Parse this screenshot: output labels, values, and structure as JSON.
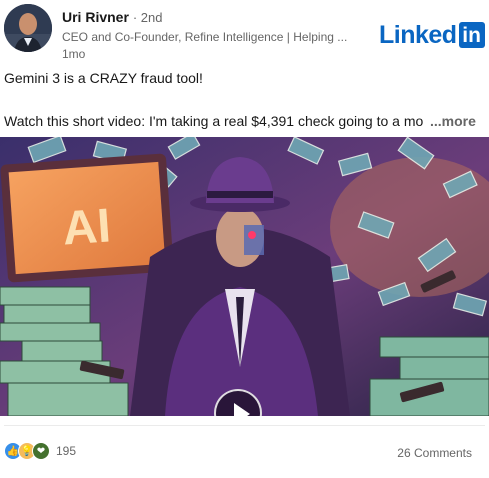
{
  "author": {
    "name": "Uri Rivner",
    "degree": "· 2nd",
    "headline": "CEO and Co-Founder, Refine Intelligence | Helping ...",
    "time": "1mo"
  },
  "brand": {
    "logo_text": "Linked",
    "logo_box": "in",
    "color": "#0a66c2"
  },
  "post": {
    "line1": "Gemini 3 is a CRAZY fraud tool!",
    "line2": "Watch this short video: I'm taking a real $4,391 check going to a mo",
    "more": "...more"
  },
  "media": {
    "screen_text": "AI",
    "play_icon": "play-icon"
  },
  "social": {
    "reaction_icons": [
      "like-icon",
      "insightful-icon",
      "support-icon"
    ],
    "reaction_count": "195",
    "comments": "26 Comments"
  }
}
